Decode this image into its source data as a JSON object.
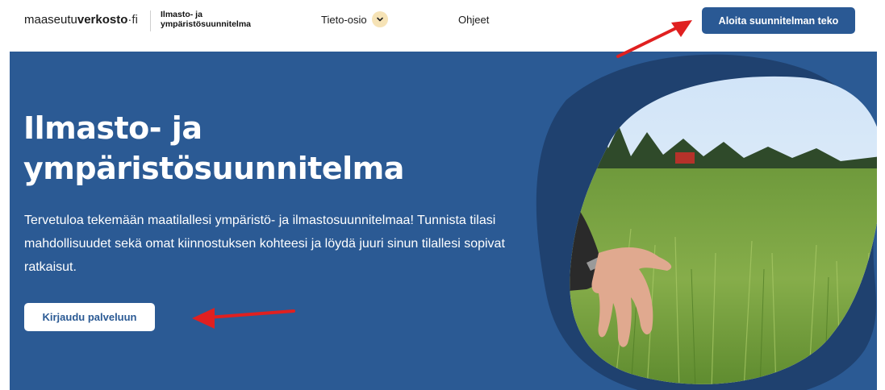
{
  "header": {
    "logo": {
      "part1": "maaseutu",
      "part2": "verkosto",
      "part3": "·fi"
    },
    "site_title": "Ilmasto- ja ympäristösuunnitelma",
    "nav": {
      "tieto": "Tieto-osio",
      "ohjeet": "Ohjeet"
    },
    "cta": "Aloita suunnitelman teko"
  },
  "hero": {
    "title_line1": "Ilmasto- ja",
    "title_line2": "ympäristösuunnitelma",
    "intro": "Tervetuloa tekemään maatilallesi ympäristö- ja ilmastosuunnitelmaa! Tunnista tilasi mahdollisuudet sekä omat kiinnostuksen kohteesi ja löydä juuri sinun tilallesi sopivat ratkaisut.",
    "login_button": "Kirjaudu palveluun"
  },
  "colors": {
    "brand_blue": "#2b5a94",
    "dark_blob": "#1f416f",
    "annotation_arrow": "#e02020",
    "chevron_bg": "#f6e3b6"
  },
  "icons": {
    "dropdown": "chevron-down-icon"
  }
}
